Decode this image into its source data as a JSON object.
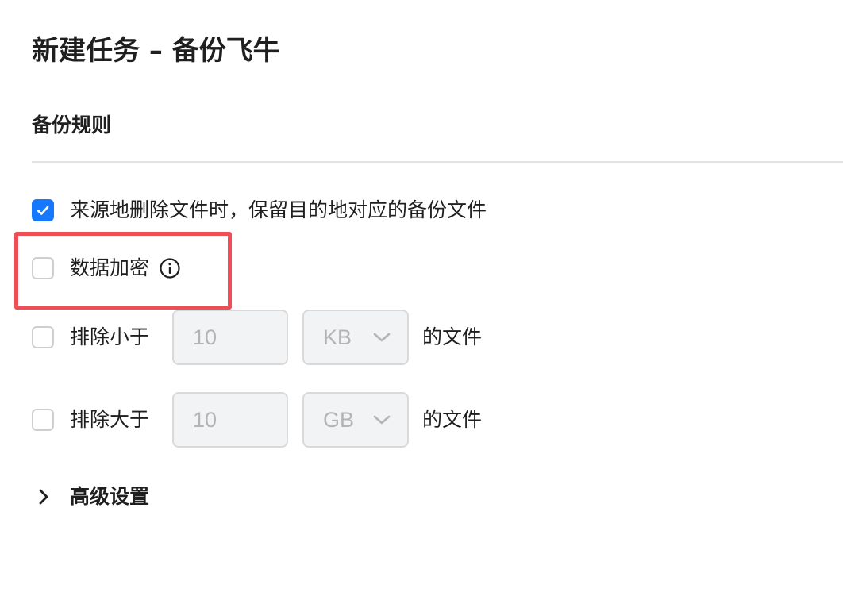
{
  "page": {
    "title": "新建任务 – 备份飞牛"
  },
  "section": {
    "title": "备份规则"
  },
  "options": {
    "keep_backup": {
      "label": "来源地删除文件时，保留目的地对应的备份文件",
      "checked": true
    },
    "encryption": {
      "label": "数据加密",
      "checked": false,
      "info_icon": "info-circle-icon"
    },
    "exclude_smaller": {
      "label": "排除小于",
      "checked": false,
      "value": "10",
      "unit": "KB",
      "suffix": "的文件"
    },
    "exclude_larger": {
      "label": "排除大于",
      "checked": false,
      "value": "10",
      "unit": "GB",
      "suffix": "的文件"
    }
  },
  "advanced": {
    "label": "高级设置",
    "icon": "chevron-right-icon",
    "expanded": false
  },
  "colors": {
    "accent": "#1677ff",
    "highlight": "#ee4f56",
    "disabled_bg": "#f2f3f5",
    "disabled_text": "#b4b4b4"
  }
}
